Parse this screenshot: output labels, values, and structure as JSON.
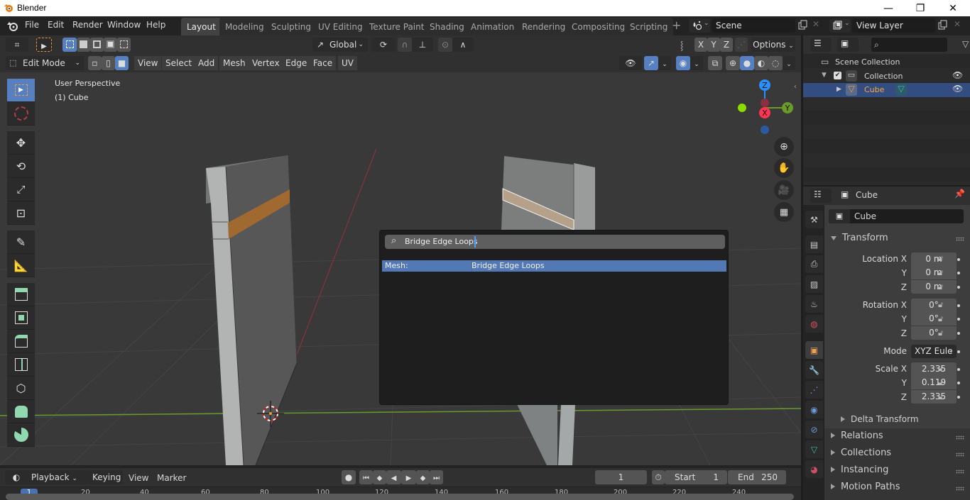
{
  "window": {
    "title": "Blender",
    "minimize": "—",
    "maximize": "❐",
    "close": "✕"
  },
  "menubar": {
    "items": [
      "File",
      "Edit",
      "Render",
      "Window",
      "Help"
    ],
    "workspaces": [
      "Layout",
      "Modeling",
      "Sculpting",
      "UV Editing",
      "Texture Paint",
      "Shading",
      "Animation",
      "Rendering",
      "Compositing",
      "Scripting"
    ],
    "active_workspace": "Layout",
    "add_workspace": "+",
    "scene": "Scene",
    "view_layer": "View Layer"
  },
  "viewport_header": {
    "orientation": "Global",
    "axes": [
      "X",
      "Y",
      "Z"
    ],
    "options": "Options",
    "mode": "Edit Mode",
    "menus": [
      "View",
      "Select",
      "Add",
      "Mesh",
      "Vertex",
      "Edge",
      "Face",
      "UV"
    ]
  },
  "viewport": {
    "view_name": "User Perspective",
    "object_info": "(1) Cube",
    "gizmo": {
      "x": "X",
      "y": "Y",
      "z": "Z"
    },
    "colors": {
      "x": "#ff3352",
      "y": "#8bdc00",
      "z": "#2b90ff",
      "selection": "#e08a2c"
    }
  },
  "toolbar": {
    "tools": [
      "select-box",
      "cursor",
      "move",
      "rotate",
      "scale",
      "transform",
      "annotate",
      "measure",
      "extrude-region",
      "inset-faces",
      "bevel",
      "loop-cut",
      "knife",
      "poly-build",
      "spin"
    ],
    "active": "select-box"
  },
  "search_popup": {
    "query": "Bridge Edge Loops",
    "results": [
      {
        "category": "Mesh:",
        "label": "Bridge Edge Loops",
        "highlighted": true
      }
    ]
  },
  "timeline": {
    "menus": [
      "Playback",
      "Keying",
      "View",
      "Marker"
    ],
    "current_frame": "1",
    "start_label": "Start",
    "start": "1",
    "end_label": "End",
    "end": "250",
    "ruler": [
      "1",
      "20",
      "40",
      "60",
      "80",
      "100",
      "120",
      "140",
      "160",
      "180",
      "200",
      "220",
      "240"
    ]
  },
  "outliner": {
    "search_placeholder": "",
    "items": [
      {
        "label": "Scene Collection",
        "level": 0
      },
      {
        "label": "Collection",
        "level": 1,
        "checked": true,
        "visible": true
      },
      {
        "label": "Cube",
        "level": 2,
        "selected": true,
        "visible": true
      }
    ]
  },
  "properties": {
    "header_object": "Cube",
    "object_name": "Cube",
    "transform_title": "Transform",
    "location": {
      "label": "Location X",
      "x": "0 m",
      "y": "0 m",
      "z": "0 m"
    },
    "rotation": {
      "label": "Rotation X",
      "x": "0°",
      "y": "0°",
      "z": "0°"
    },
    "mode_label": "Mode",
    "mode_value": "XYZ Eule",
    "scale": {
      "label": "Scale X",
      "x": "2.335",
      "y": "0.119",
      "z": "2.335"
    },
    "axis_labels": {
      "y": "Y",
      "z": "Z"
    },
    "subsections": [
      "Delta Transform"
    ],
    "panels": [
      "Relations",
      "Collections",
      "Instancing",
      "Motion Paths"
    ]
  }
}
